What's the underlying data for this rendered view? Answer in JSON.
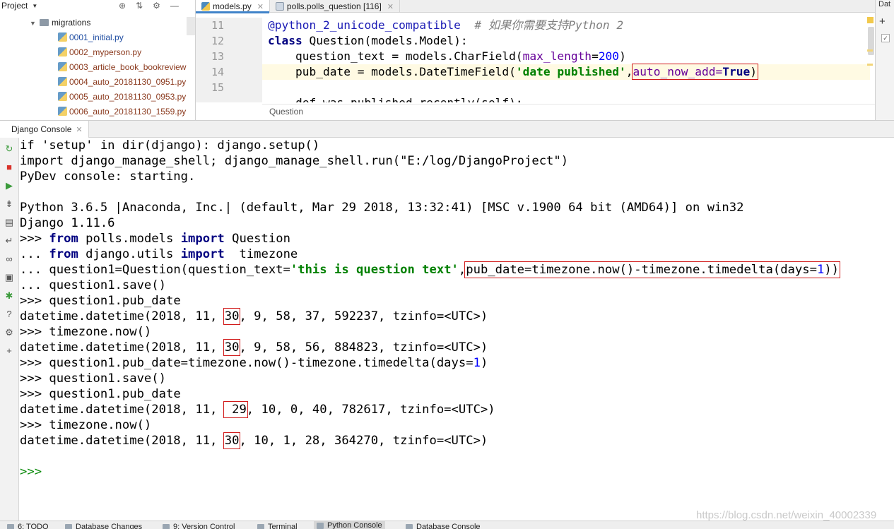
{
  "project": {
    "title": "Project",
    "folder": "migrations",
    "files": [
      "0001_initial.py",
      "0002_myperson.py",
      "0003_article_book_bookreview",
      "0004_auto_20181130_0951.py",
      "0005_auto_20181130_0953.py",
      "0006_auto_20181130_1559.py"
    ]
  },
  "editor": {
    "tabs": [
      "models.py",
      "polls.polls_question [116]"
    ],
    "line_numbers": [
      "11",
      "12",
      "13",
      "14",
      "15"
    ],
    "lines": {
      "l11_a": "@python_2_unicode_compatible",
      "l11_comment": "# 如果你需要支持Python 2",
      "l12_kw": "class",
      "l12_rest": " Question(models.Model):",
      "l13_a": "    question_text = models.CharField(",
      "l13_param": "max_length",
      "l13_eq": "=",
      "l13_num": "200",
      "l13_close": ")",
      "l14_a": "    pub_date = models.DateTimeField(",
      "l14_str": "'date published'",
      "l14_comma": ",",
      "l14_box_a": "auto_now_add=",
      "l14_box_kw": "True",
      "l14_box_close": ")",
      "l16_a": "    def was_published_recently(self):"
    },
    "breadcrumb": "Question",
    "right_label": "Dat"
  },
  "console": {
    "tab": "Django Console",
    "lines": {
      "c1": "if 'setup' in dir(django): django.setup()",
      "c2": "import django_manage_shell; django_manage_shell.run(\"E:/log/DjangoProject\")",
      "c3": "PyDev console: starting.",
      "c5": "Python 3.6.5 |Anaconda, Inc.| (default, Mar 29 2018, 13:32:41) [MSC v.1900 64 bit (AMD64)] on win32",
      "c6": "Django 1.11.6",
      "c7_p": ">>> ",
      "c7_kw1": "from",
      "c7_mid": " polls.models ",
      "c7_kw2": "import",
      "c7_end": " Question",
      "c8_p": "... ",
      "c8_kw1": "from",
      "c8_mid": " django.utils ",
      "c8_kw2": "import",
      "c8_end": "  timezone",
      "c9_p": "... ",
      "c9_a": "question1=Question(question_text=",
      "c9_str": "'this is question text'",
      "c9_comma": ",",
      "c9_box_a": "pub_date=timezone.now()-timezone.timedelta(days=",
      "c9_box_num": "1",
      "c9_box_close": "))",
      "c10_p": "... ",
      "c10_a": "question1.save()",
      "c11_p": ">>> ",
      "c11_a": "question1.pub_date",
      "c12_a": "datetime.datetime(2018, 11, ",
      "c12_box": "30",
      "c12_b": ", 9, 58, 37, 592237, tzinfo=<UTC>)",
      "c13_p": ">>> ",
      "c13_a": "timezone.now()",
      "c14_a": "datetime.datetime(2018, 11, ",
      "c14_box": "30",
      "c14_b": ", 9, 58, 56, 884823, tzinfo=<UTC>)",
      "c15_p": ">>> ",
      "c15_a": "question1.pub_date=timezone.now()-timezone.timedelta(days=",
      "c15_num": "1",
      "c15_close": ")",
      "c16_p": ">>> ",
      "c16_a": "question1.save()",
      "c17_p": ">>> ",
      "c17_a": "question1.pub_date",
      "c18_a": "datetime.datetime(2018, 11, ",
      "c18_box": " 29",
      "c18_b": ", 10, 0, 40, 782617, tzinfo=<UTC>)",
      "c19_p": ">>> ",
      "c19_a": "timezone.now()",
      "c20_a": "datetime.datetime(2018, 11, ",
      "c20_box": "30",
      "c20_b": ", 10, 1, 28, 364270, tzinfo=<UTC>)",
      "prompt": ">>>"
    }
  },
  "watermark": "https://blog.csdn.net/weixin_40002339",
  "status": {
    "items": [
      "6: TODO",
      "Database Changes",
      "9: Version Control",
      "Terminal",
      "Python Console",
      "Database Console"
    ]
  },
  "colors": {
    "keyword": "#000080",
    "string": "#008000",
    "number": "#0000ff",
    "highlight_box": "#d11a1a",
    "current_line": "#fffae3"
  }
}
